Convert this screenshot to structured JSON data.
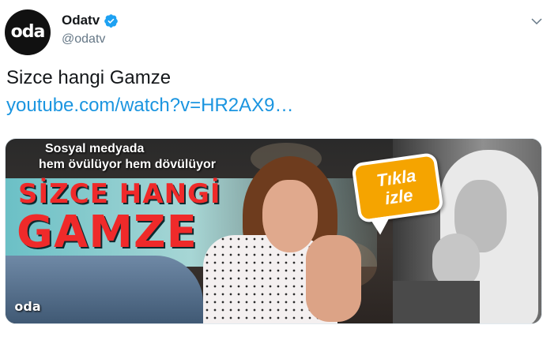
{
  "author": {
    "display_name": "Odatv",
    "handle": "@odatv",
    "avatar_logo": "oda",
    "verified_icon": "verified-badge-icon",
    "colors": {
      "verified": "#1da1f2"
    }
  },
  "menu": {
    "icon": "chevron-down-icon"
  },
  "tweet": {
    "text": "Sizce hangi Gamze",
    "link": "youtube.com/watch?v=HR2AX9…",
    "link_color": "#1b95e0"
  },
  "media": {
    "subtitle_line1": "Sosyal medyada",
    "subtitle_line2": "hem övülüyor hem dövülüyor",
    "headline_line1": "SİZCE HANGİ",
    "headline_line2": "GAMZE",
    "callout_line1": "Tıkla",
    "callout_line2": "izle",
    "logo": "oda"
  }
}
